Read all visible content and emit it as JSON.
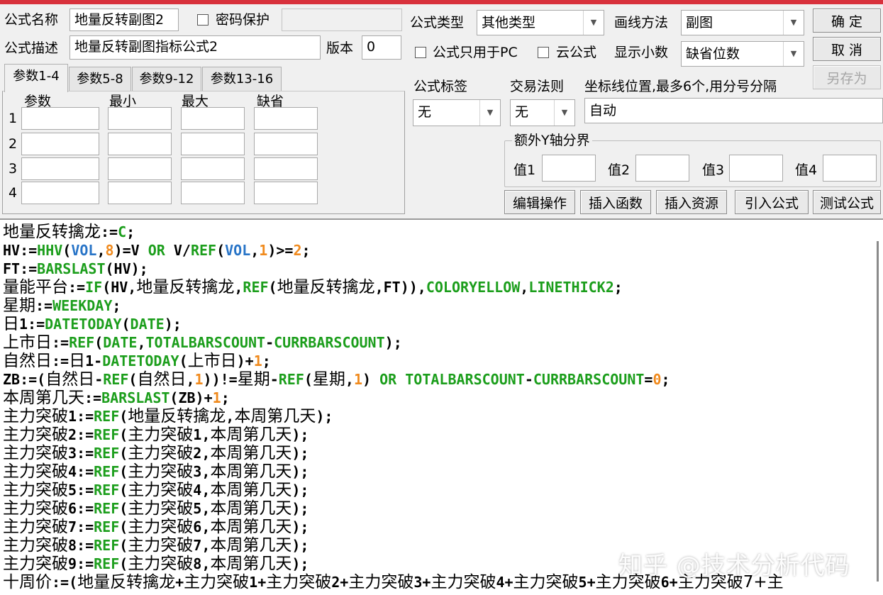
{
  "form": {
    "name_label": "公式名称",
    "name_value": "地量反转副图2",
    "password_label": "密码保护",
    "desc_label": "公式描述",
    "desc_value": "地量反转副图指标公式2",
    "version_label": "版本",
    "version_value": "0",
    "type_label": "公式类型",
    "type_value": "其他类型",
    "draw_label": "画线方法",
    "draw_value": "副图",
    "pc_only_label": "公式只用于PC",
    "cloud_label": "云公式",
    "decimals_label": "显示小数",
    "decimals_value": "缺省位数",
    "tag_label": "公式标签",
    "tag_value": "无",
    "rule_label": "交易法则",
    "rule_value": "无",
    "axis_label": "坐标线位置,最多6个,用分号分隔",
    "axis_value": "自动",
    "ybound_label": "额外Y轴分界",
    "y1": "值1",
    "y2": "值2",
    "y3": "值3",
    "y4": "值4"
  },
  "buttons": {
    "ok": "确 定",
    "cancel": "取 消",
    "save_as": "另存为",
    "edit": "编辑操作",
    "insert_func": "插入函数",
    "insert_res": "插入资源",
    "import": "引入公式",
    "test": "测试公式"
  },
  "tabs": [
    "参数1-4",
    "参数5-8",
    "参数9-12",
    "参数13-16"
  ],
  "params": {
    "headers": [
      "参数",
      "最小",
      "最大",
      "缺省"
    ],
    "rows": [
      "1",
      "2",
      "3",
      "4"
    ]
  },
  "code_lines": [
    [
      [
        "t",
        "地量反转擒龙"
      ],
      [
        "t",
        ":="
      ],
      [
        "k",
        "C"
      ],
      [
        "t",
        ";"
      ]
    ],
    [
      [
        "t",
        "HV:="
      ],
      [
        "k",
        "HHV"
      ],
      [
        "t",
        "("
      ],
      [
        "v",
        "VOL"
      ],
      [
        "t",
        ","
      ],
      [
        "n",
        "8"
      ],
      [
        "t",
        ")=V "
      ],
      [
        "k",
        "OR"
      ],
      [
        "t",
        " V/"
      ],
      [
        "k",
        "REF"
      ],
      [
        "t",
        "("
      ],
      [
        "v",
        "VOL"
      ],
      [
        "t",
        ","
      ],
      [
        "n",
        "1"
      ],
      [
        "t",
        ")>="
      ],
      [
        "n",
        "2"
      ],
      [
        "t",
        ";"
      ]
    ],
    [
      [
        "t",
        "FT:="
      ],
      [
        "k",
        "BARSLAST"
      ],
      [
        "t",
        "(HV);"
      ]
    ],
    [
      [
        "t",
        "量能平台"
      ],
      [
        "t",
        ":="
      ],
      [
        "k",
        "IF"
      ],
      [
        "t",
        "(HV,"
      ],
      [
        "t",
        "地量反转擒龙"
      ],
      [
        "t",
        ","
      ],
      [
        "k",
        "REF"
      ],
      [
        "t",
        "("
      ],
      [
        "t",
        "地量反转擒龙"
      ],
      [
        "t",
        ",FT)),"
      ],
      [
        "k",
        "COLORYELLOW"
      ],
      [
        "t",
        ","
      ],
      [
        "k",
        "LINETHICK2"
      ],
      [
        "t",
        ";"
      ]
    ],
    [
      [
        "t",
        "星期"
      ],
      [
        "t",
        ":="
      ],
      [
        "k",
        "WEEKDAY"
      ],
      [
        "t",
        ";"
      ]
    ],
    [
      [
        "t",
        "日"
      ],
      [
        "t",
        "1:="
      ],
      [
        "k",
        "DATETODAY"
      ],
      [
        "t",
        "("
      ],
      [
        "k",
        "DATE"
      ],
      [
        "t",
        ");"
      ]
    ],
    [
      [
        "t",
        "上市日"
      ],
      [
        "t",
        ":="
      ],
      [
        "k",
        "REF"
      ],
      [
        "t",
        "("
      ],
      [
        "k",
        "DATE"
      ],
      [
        "t",
        ","
      ],
      [
        "k",
        "TOTALBARSCOUNT"
      ],
      [
        "t",
        "-"
      ],
      [
        "k",
        "CURRBARSCOUNT"
      ],
      [
        "t",
        ");"
      ]
    ],
    [
      [
        "t",
        "自然日"
      ],
      [
        "t",
        ":="
      ],
      [
        "t",
        "日"
      ],
      [
        "t",
        "1-"
      ],
      [
        "k",
        "DATETODAY"
      ],
      [
        "t",
        "("
      ],
      [
        "t",
        "上市日"
      ],
      [
        "t",
        ")+"
      ],
      [
        "n",
        "1"
      ],
      [
        "t",
        ";"
      ]
    ],
    [
      [
        "t",
        "ZB:=("
      ],
      [
        "t",
        "自然日"
      ],
      [
        "t",
        "-"
      ],
      [
        "k",
        "REF"
      ],
      [
        "t",
        "("
      ],
      [
        "t",
        "自然日"
      ],
      [
        "t",
        ","
      ],
      [
        "n",
        "1"
      ],
      [
        "t",
        "))!="
      ],
      [
        "t",
        "星期"
      ],
      [
        "t",
        "-"
      ],
      [
        "k",
        "REF"
      ],
      [
        "t",
        "("
      ],
      [
        "t",
        "星期"
      ],
      [
        "t",
        ","
      ],
      [
        "n",
        "1"
      ],
      [
        "t",
        ") "
      ],
      [
        "k",
        "OR"
      ],
      [
        "t",
        " "
      ],
      [
        "k",
        "TOTALBARSCOUNT"
      ],
      [
        "t",
        "-"
      ],
      [
        "k",
        "CURRBARSCOUNT"
      ],
      [
        "t",
        "="
      ],
      [
        "n",
        "0"
      ],
      [
        "t",
        ";"
      ]
    ],
    [
      [
        "t",
        "本周第几天"
      ],
      [
        "t",
        ":="
      ],
      [
        "k",
        "BARSLAST"
      ],
      [
        "t",
        "(ZB)+"
      ],
      [
        "n",
        "1"
      ],
      [
        "t",
        ";"
      ]
    ],
    [
      [
        "t",
        "主力突破"
      ],
      [
        "t",
        "1:="
      ],
      [
        "k",
        "REF"
      ],
      [
        "t",
        "("
      ],
      [
        "t",
        "地量反转擒龙"
      ],
      [
        "t",
        ","
      ],
      [
        "t",
        "本周第几天"
      ],
      [
        "t",
        ");"
      ]
    ],
    [
      [
        "t",
        "主力突破"
      ],
      [
        "t",
        "2:="
      ],
      [
        "k",
        "REF"
      ],
      [
        "t",
        "("
      ],
      [
        "t",
        "主力突破"
      ],
      [
        "t",
        "1,"
      ],
      [
        "t",
        "本周第几天"
      ],
      [
        "t",
        ");"
      ]
    ],
    [
      [
        "t",
        "主力突破"
      ],
      [
        "t",
        "3:="
      ],
      [
        "k",
        "REF"
      ],
      [
        "t",
        "("
      ],
      [
        "t",
        "主力突破"
      ],
      [
        "t",
        "2,"
      ],
      [
        "t",
        "本周第几天"
      ],
      [
        "t",
        ");"
      ]
    ],
    [
      [
        "t",
        "主力突破"
      ],
      [
        "t",
        "4:="
      ],
      [
        "k",
        "REF"
      ],
      [
        "t",
        "("
      ],
      [
        "t",
        "主力突破"
      ],
      [
        "t",
        "3,"
      ],
      [
        "t",
        "本周第几天"
      ],
      [
        "t",
        ");"
      ]
    ],
    [
      [
        "t",
        "主力突破"
      ],
      [
        "t",
        "5:="
      ],
      [
        "k",
        "REF"
      ],
      [
        "t",
        "("
      ],
      [
        "t",
        "主力突破"
      ],
      [
        "t",
        "4,"
      ],
      [
        "t",
        "本周第几天"
      ],
      [
        "t",
        ");"
      ]
    ],
    [
      [
        "t",
        "主力突破"
      ],
      [
        "t",
        "6:="
      ],
      [
        "k",
        "REF"
      ],
      [
        "t",
        "("
      ],
      [
        "t",
        "主力突破"
      ],
      [
        "t",
        "5,"
      ],
      [
        "t",
        "本周第几天"
      ],
      [
        "t",
        ");"
      ]
    ],
    [
      [
        "t",
        "主力突破"
      ],
      [
        "t",
        "7:="
      ],
      [
        "k",
        "REF"
      ],
      [
        "t",
        "("
      ],
      [
        "t",
        "主力突破"
      ],
      [
        "t",
        "6,"
      ],
      [
        "t",
        "本周第几天"
      ],
      [
        "t",
        ");"
      ]
    ],
    [
      [
        "t",
        "主力突破"
      ],
      [
        "t",
        "8:="
      ],
      [
        "k",
        "REF"
      ],
      [
        "t",
        "("
      ],
      [
        "t",
        "主力突破"
      ],
      [
        "t",
        "7,"
      ],
      [
        "t",
        "本周第几天"
      ],
      [
        "t",
        ");"
      ]
    ],
    [
      [
        "t",
        "主力突破"
      ],
      [
        "t",
        "9:="
      ],
      [
        "k",
        "REF"
      ],
      [
        "t",
        "("
      ],
      [
        "t",
        "主力突破"
      ],
      [
        "t",
        "8,"
      ],
      [
        "t",
        "本周第几天"
      ],
      [
        "t",
        ");"
      ]
    ],
    [
      [
        "t",
        "十周价"
      ],
      [
        "t",
        ":=("
      ],
      [
        "t",
        "地量反转擒龙"
      ],
      [
        "t",
        "+"
      ],
      [
        "t",
        "主力突破"
      ],
      [
        "t",
        "1+"
      ],
      [
        "t",
        "主力突破"
      ],
      [
        "t",
        "2+"
      ],
      [
        "t",
        "主力突破"
      ],
      [
        "t",
        "3+"
      ],
      [
        "t",
        "主力突破"
      ],
      [
        "t",
        "4+"
      ],
      [
        "t",
        "主力突破"
      ],
      [
        "t",
        "5+"
      ],
      [
        "t",
        "主力突破"
      ],
      [
        "t",
        "6+"
      ],
      [
        "t",
        "主力突破"
      ],
      [
        "t",
        "7+主"
      ]
    ]
  ],
  "watermark": "知乎 @技术分析代码",
  "colors": {
    "keyword": "#1c9e1c",
    "number": "#f08a1d",
    "variable": "#2874c7",
    "titlebar": "#d8313c"
  }
}
